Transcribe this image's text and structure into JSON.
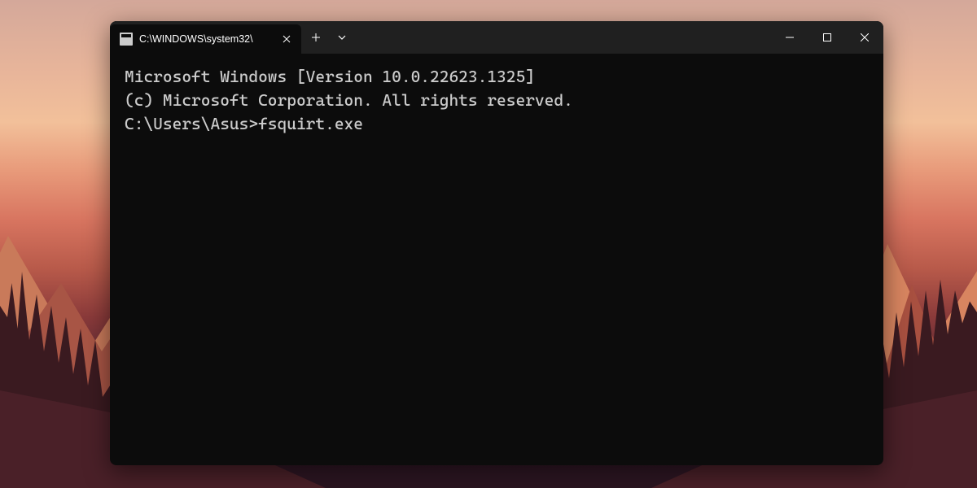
{
  "tab": {
    "title": "C:\\WINDOWS\\system32\\"
  },
  "terminal": {
    "line1": "Microsoft Windows [Version 10.0.22623.1325]",
    "line2": "(c) Microsoft Corporation. All rights reserved.",
    "blank": "",
    "prompt": "C:\\Users\\Asus>",
    "command": "fsquirt.exe"
  }
}
